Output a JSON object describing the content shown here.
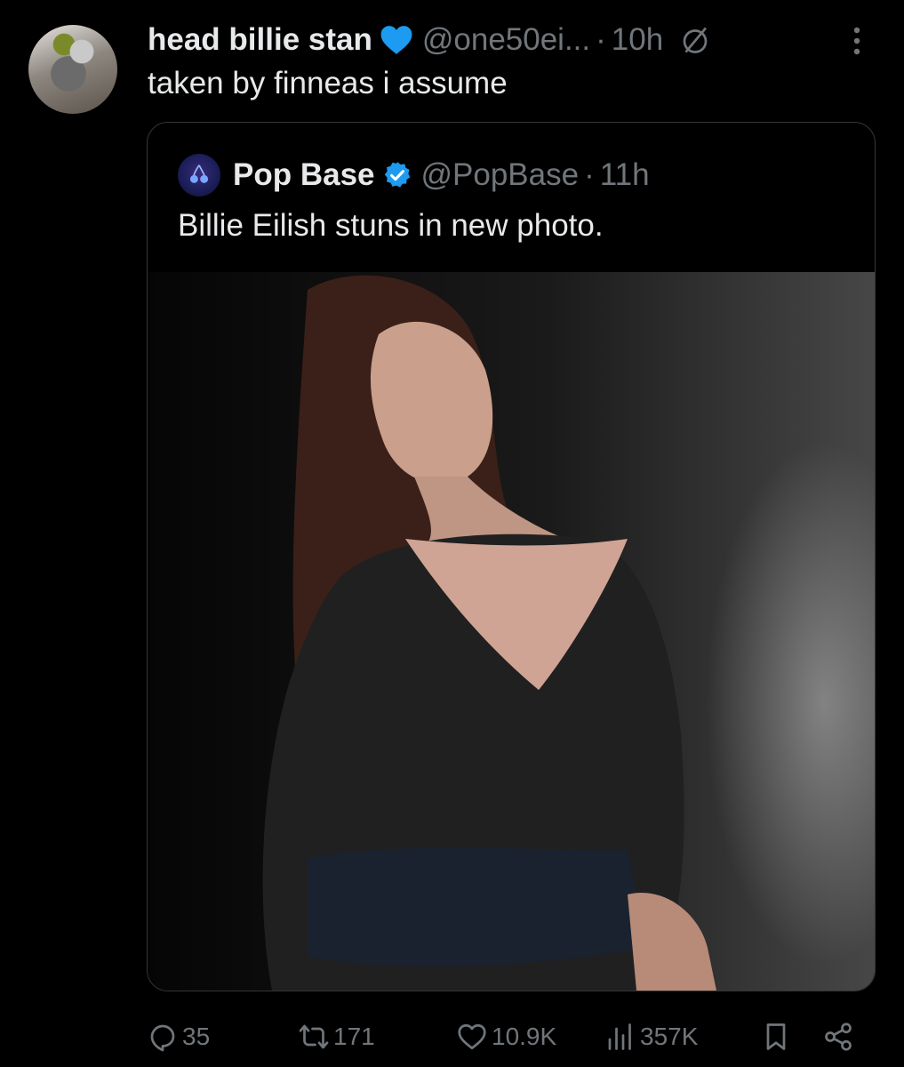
{
  "post": {
    "author_name": "head billie stan",
    "author_handle": "@one50ei...",
    "separator": "·",
    "time": "10h",
    "text": "taken by finneas i assume"
  },
  "quote": {
    "author_name": "Pop Base",
    "author_handle": "@PopBase",
    "separator": "·",
    "time": "11h",
    "text": "Billie Eilish stuns in new photo."
  },
  "actions": {
    "replies": "35",
    "reposts": "171",
    "likes": "10.9K",
    "views": "357K"
  },
  "icons": [
    "heart-emoji-icon",
    "slash-circle-icon",
    "more-icon",
    "verified-badge-icon",
    "reply-icon",
    "repost-icon",
    "like-icon",
    "views-icon",
    "bookmark-icon",
    "share-icon"
  ],
  "colors": {
    "background": "#000000",
    "text": "#e7e9ea",
    "muted": "#71767b",
    "verified": "#1d9bf0",
    "heart": "#1d9bf0",
    "border": "#333639"
  }
}
